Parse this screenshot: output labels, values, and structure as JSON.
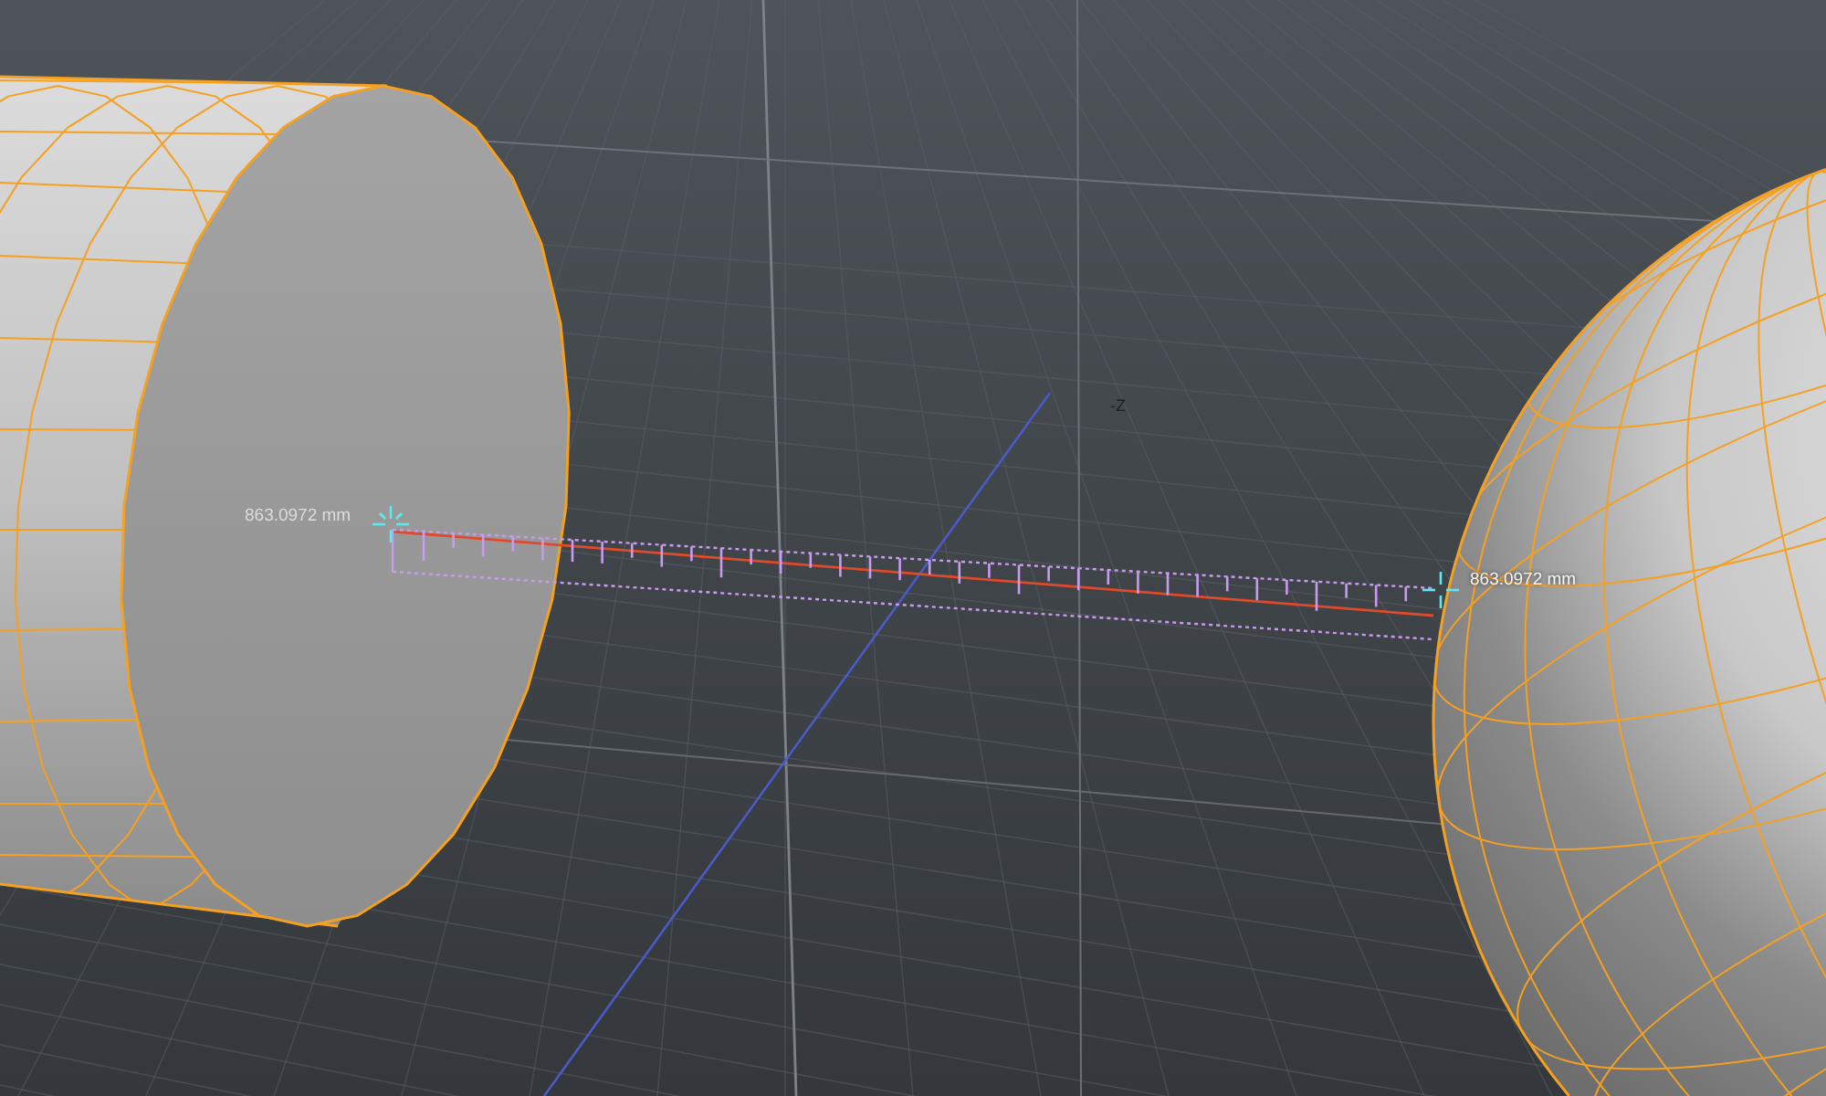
{
  "viewport": {
    "axis_label": "-Z"
  },
  "measurement": {
    "start_label": "863.0972 mm",
    "end_label": "863.0972 mm"
  }
}
